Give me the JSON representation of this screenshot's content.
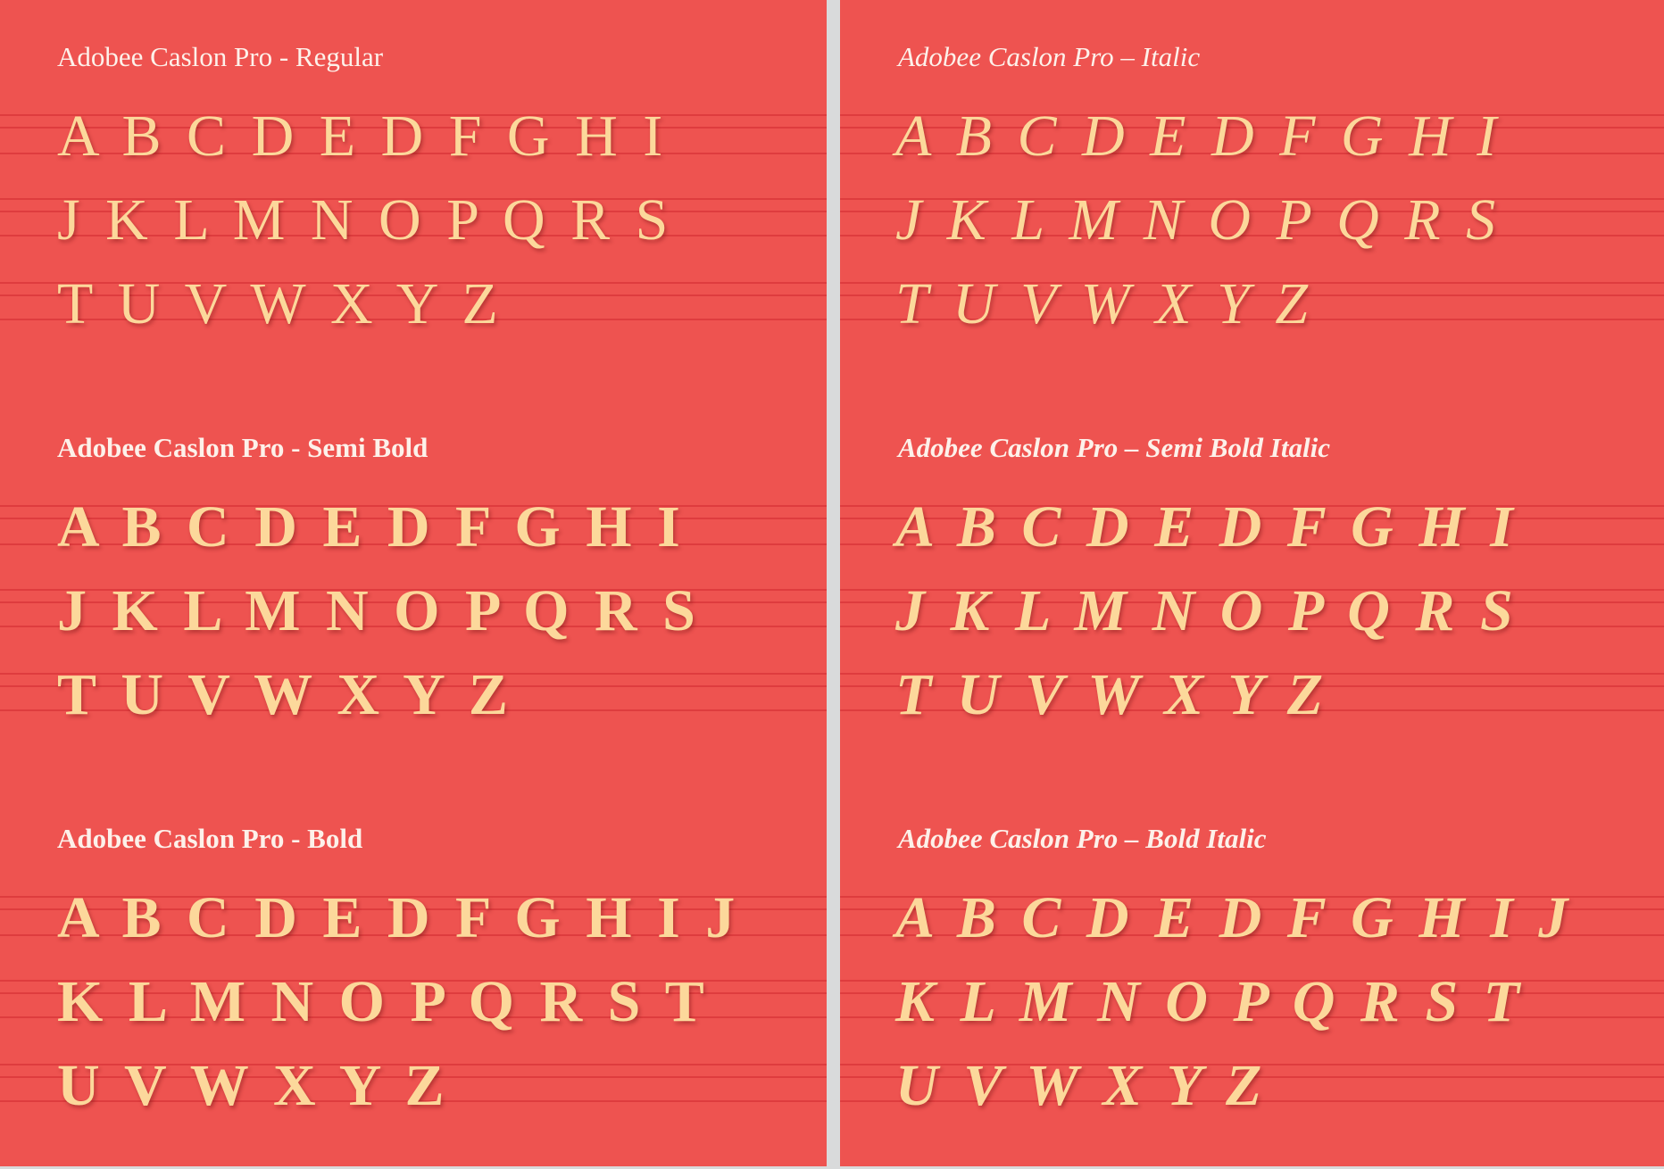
{
  "left_page": {
    "sections": [
      {
        "title": "Adobee Caslon Pro - Regular",
        "rows": [
          "A B C D E D F G H I",
          "J K L M N O P Q R S",
          "T U V W X Y Z"
        ]
      },
      {
        "title": "Adobee Caslon Pro - Semi Bold",
        "rows": [
          "A B C D E D F G H I",
          "J K L M N O P Q R S",
          "T U V W X Y Z"
        ]
      },
      {
        "title": "Adobee Caslon Pro - Bold",
        "rows": [
          "A B C D E D F G H I J",
          "K L M N O P Q R S T",
          "U V W X Y Z"
        ]
      }
    ]
  },
  "right_page": {
    "sections": [
      {
        "title": "Adobee Caslon Pro – Italic",
        "rows": [
          "A B C D E D F G H I",
          "J K L M N O P Q R S",
          "T U V W X Y Z"
        ]
      },
      {
        "title": "Adobee Caslon Pro – Semi Bold Italic",
        "rows": [
          "A B C D E D F G H I",
          "J K L M N O P Q R S",
          "T U V W X Y Z"
        ]
      },
      {
        "title": "Adobee Caslon Pro – Bold Italic",
        "rows": [
          "A B C D E D F G H I J",
          "K L M N O P Q R S T",
          "U V W X Y Z"
        ]
      }
    ]
  },
  "colors": {
    "page_background": "#ee5350",
    "guide_line": "#dc3a3c",
    "title_text": "#fdf1ea",
    "glyph_text": "#fcd89b",
    "gutter": "#d9dadb"
  }
}
